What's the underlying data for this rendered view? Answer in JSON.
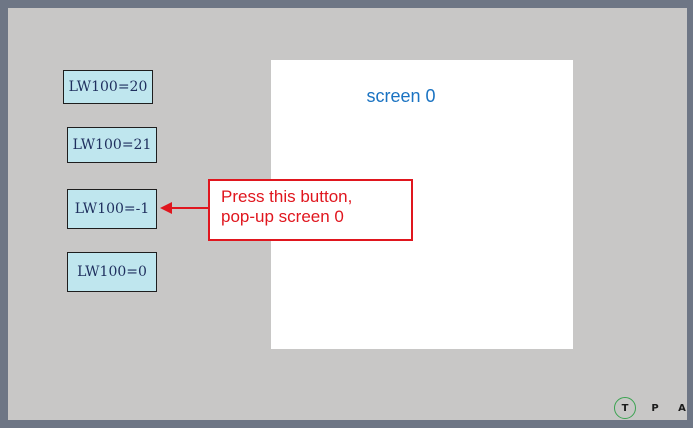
{
  "buttons": [
    {
      "label": "LW100=20"
    },
    {
      "label": "LW100=21"
    },
    {
      "label": "LW100=-1"
    },
    {
      "label": "LW100=0"
    }
  ],
  "popup": {
    "title": "screen 0"
  },
  "callout": {
    "line1": "Press this button,",
    "line2": "pop-up screen 0"
  },
  "modes": [
    {
      "label": "T",
      "active": true
    },
    {
      "label": "P",
      "active": false
    },
    {
      "label": "A",
      "active": false
    }
  ],
  "colors": {
    "frame": "#6e7685",
    "background": "#c8c7c6",
    "button_fill": "#bfe6ee",
    "callout_red": "#e0161e",
    "title_blue": "#1a73c2",
    "mode_ring": "#3aa350"
  },
  "icons": {
    "callout_pointer": "left-arrow-icon"
  }
}
